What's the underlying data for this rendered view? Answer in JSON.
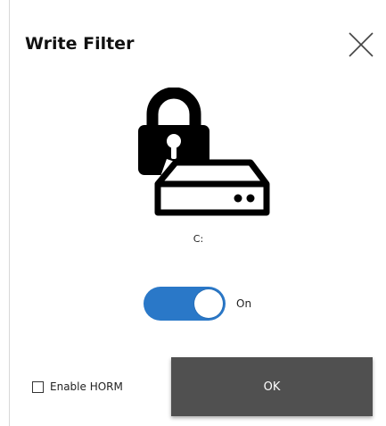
{
  "dialog": {
    "title": "Write Filter",
    "close_icon": "close-icon"
  },
  "hero": {
    "icons": [
      "lock-icon",
      "hard-drive-icon"
    ]
  },
  "drive": {
    "label": "C:"
  },
  "toggle": {
    "state": true,
    "label": "On",
    "accent_color": "#2a78c8"
  },
  "horm": {
    "label": "Enable HORM",
    "checked": false
  },
  "ok_button": {
    "label": "OK",
    "color": "#505050"
  }
}
